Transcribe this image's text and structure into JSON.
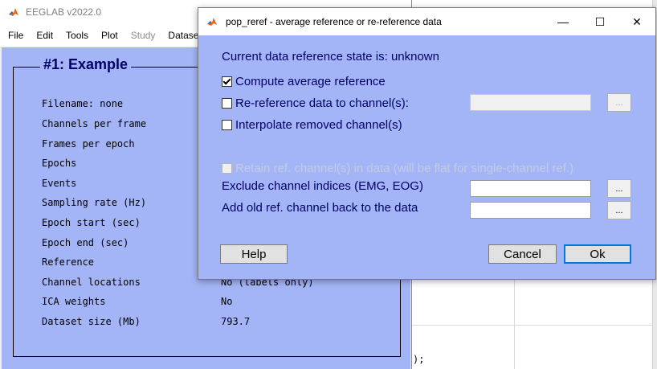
{
  "background": {
    "code_snippet": ");"
  },
  "eeglab": {
    "title": "EEGLAB v2022.0",
    "menu": [
      {
        "label": "File",
        "enabled": true
      },
      {
        "label": "Edit",
        "enabled": true
      },
      {
        "label": "Tools",
        "enabled": true
      },
      {
        "label": "Plot",
        "enabled": true
      },
      {
        "label": "Study",
        "enabled": false
      },
      {
        "label": "Datase",
        "enabled": true
      }
    ],
    "frame_title": "#1: Example",
    "rows": [
      {
        "label": "Filename: none",
        "value": ""
      },
      {
        "label": "Channels per frame",
        "value": ""
      },
      {
        "label": "Frames per epoch",
        "value": ""
      },
      {
        "label": "Epochs",
        "value": ""
      },
      {
        "label": "Events",
        "value": ""
      },
      {
        "label": "Sampling rate (Hz)",
        "value": ""
      },
      {
        "label": "Epoch start (sec)",
        "value": ""
      },
      {
        "label": "Epoch end (sec)",
        "value": ""
      },
      {
        "label": "Reference",
        "value": ""
      },
      {
        "label": "Channel locations",
        "value": "No (labels only)"
      },
      {
        "label": "ICA weights",
        "value": "No"
      },
      {
        "label": "Dataset size (Mb)",
        "value": "793.7"
      }
    ]
  },
  "dialog": {
    "title": "pop_reref - average reference or re-reference data",
    "controls": {
      "minimize": "—",
      "maximize": "☐",
      "close": "✕"
    },
    "state_text": "Current data reference state is: unknown",
    "compute_avg": {
      "label": "Compute average reference",
      "checked": true
    },
    "reref": {
      "label": "Re-reference data to channel(s):",
      "checked": false,
      "value": ""
    },
    "interpolate": {
      "label": "Interpolate removed channel(s)",
      "checked": false
    },
    "retain": {
      "label": "Retain ref. channel(s) in data (will be flat for single-channel ref.)",
      "checked": false,
      "enabled": false
    },
    "exclude": {
      "label": "Exclude channel indices (EMG, EOG)",
      "value": ""
    },
    "add_old": {
      "label": "Add old ref. channel back to the data",
      "value": ""
    },
    "browse_label": "...",
    "buttons": {
      "help": "Help",
      "cancel": "Cancel",
      "ok": "Ok"
    }
  },
  "colors": {
    "eeglab_bg": "#a3b5f6",
    "text_navy": "#000066"
  }
}
